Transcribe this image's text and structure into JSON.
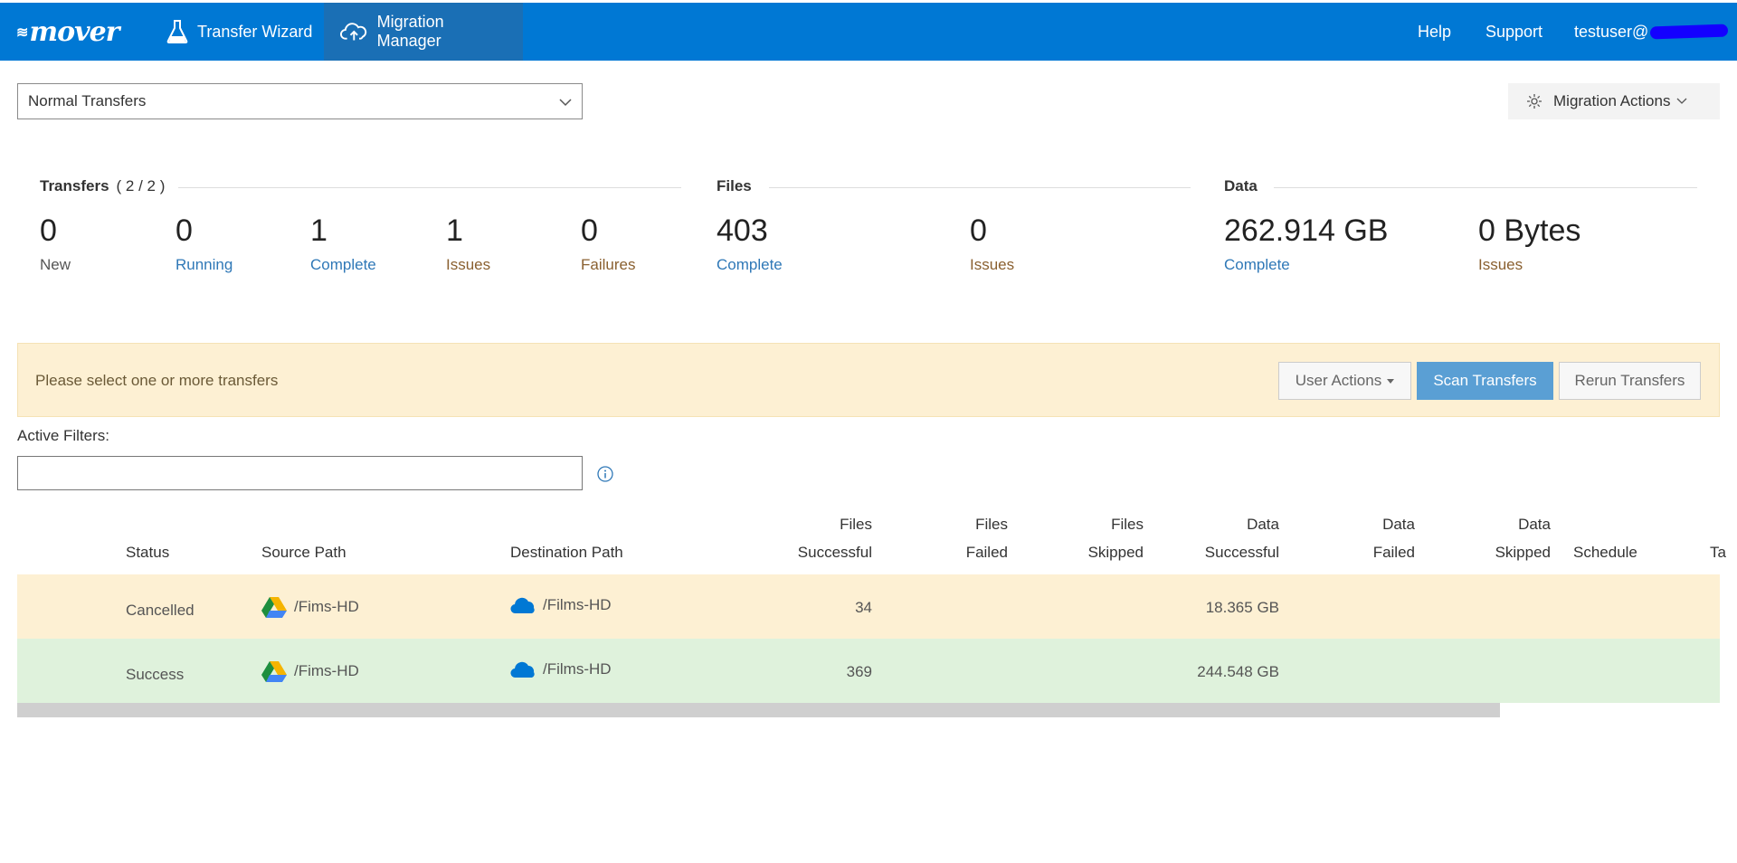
{
  "nav": {
    "logo": "mover",
    "transfer_wizard": "Transfer Wizard",
    "migration_manager": "Migration Manager",
    "help": "Help",
    "support": "Support",
    "user": "testuser@"
  },
  "toolbar": {
    "transfer_type": "Normal Transfers",
    "migration_actions": "Migration Actions"
  },
  "stats": {
    "transfers_title": "Transfers",
    "transfers_count": "( 2 / 2 )",
    "files_title": "Files",
    "data_title": "Data",
    "transfers": [
      {
        "value": "0",
        "label": "New"
      },
      {
        "value": "0",
        "label": "Running"
      },
      {
        "value": "1",
        "label": "Complete"
      },
      {
        "value": "1",
        "label": "Issues"
      },
      {
        "value": "0",
        "label": "Failures"
      }
    ],
    "files": [
      {
        "value": "403",
        "label": "Complete"
      },
      {
        "value": "0",
        "label": "Issues"
      }
    ],
    "data": [
      {
        "value": "262.914 GB",
        "label": "Complete"
      },
      {
        "value": "0 Bytes",
        "label": "Issues"
      }
    ]
  },
  "alert": {
    "message": "Please select one or more transfers",
    "user_actions": "User Actions",
    "scan_transfers": "Scan Transfers",
    "rerun_transfers": "Rerun Transfers"
  },
  "filters": {
    "label": "Active Filters:",
    "value": ""
  },
  "table": {
    "headers": {
      "status": "Status",
      "source": "Source Path",
      "destination": "Destination Path",
      "files_successful_1": "Files",
      "files_successful_2": "Successful",
      "files_failed_1": "Files",
      "files_failed_2": "Failed",
      "files_skipped_1": "Files",
      "files_skipped_2": "Skipped",
      "data_successful_1": "Data",
      "data_successful_2": "Successful",
      "data_failed_1": "Data",
      "data_failed_2": "Failed",
      "data_skipped_1": "Data",
      "data_skipped_2": "Skipped",
      "schedule": "Schedule",
      "tail": "Ta"
    },
    "rows": [
      {
        "status": "Cancelled",
        "source": "/Fims-HD",
        "destination": "/Films-HD",
        "files_successful": "34",
        "data_successful": "18.365 GB"
      },
      {
        "status": "Success",
        "source": "/Fims-HD",
        "destination": "/Films-HD",
        "files_successful": "369",
        "data_successful": "244.548 GB"
      }
    ]
  },
  "colors": {
    "nav_bg": "#0078d4",
    "cancelled_row": "#fdf0d3",
    "success_row": "#dff2dc",
    "scan_button": "#5a9fd4"
  },
  "icons": {
    "transfer_wizard": "flask-icon",
    "migration_manager": "cloud-upload-icon",
    "migration_actions": "gear-icon",
    "source": "google-drive-icon",
    "destination": "onedrive-cloud-icon",
    "filter_info": "info-icon"
  }
}
